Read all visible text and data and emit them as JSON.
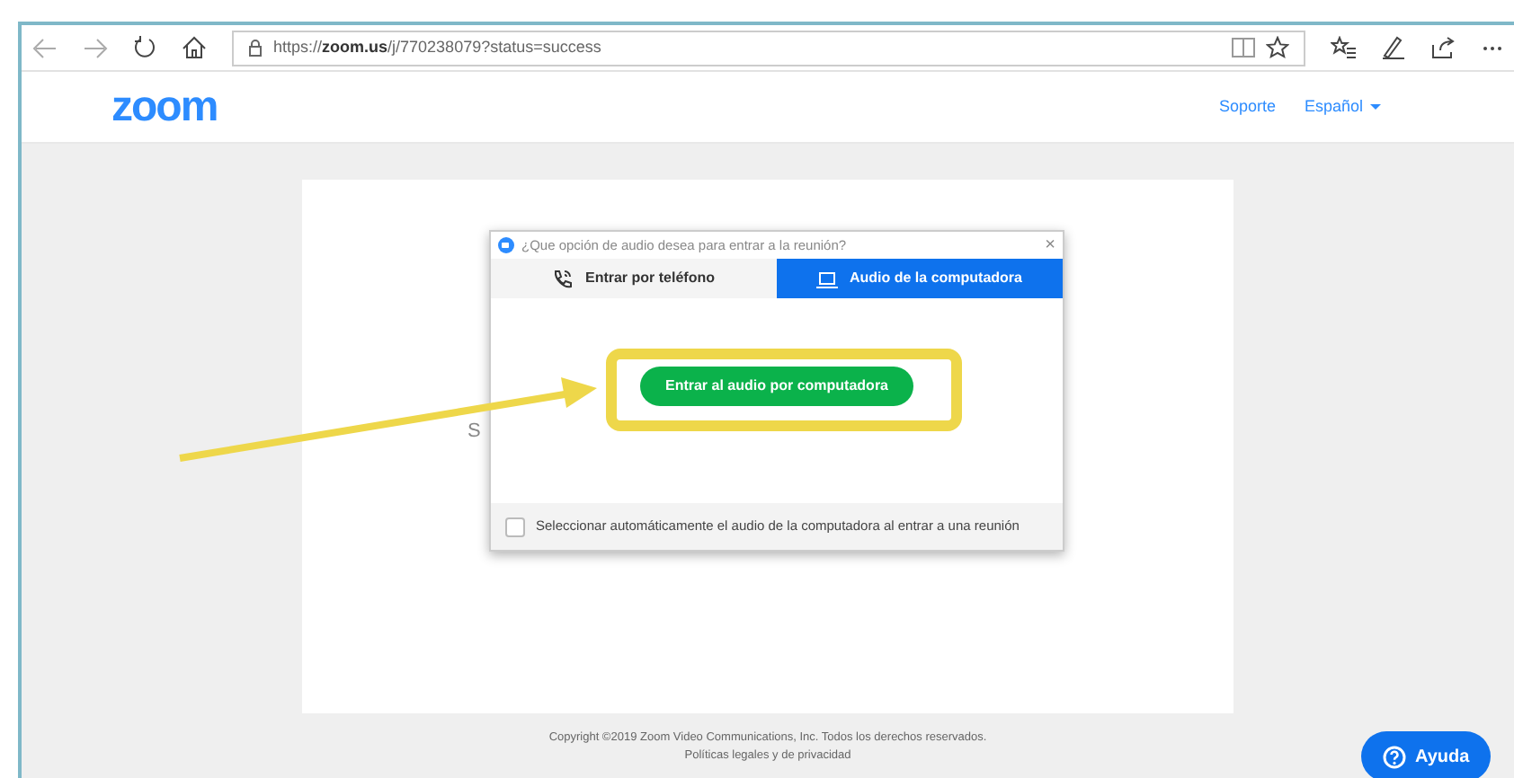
{
  "browser": {
    "url_prefix": "https://",
    "url_host": "zoom.us",
    "url_path": "/j/770238079?status=success"
  },
  "header": {
    "logo": "zoom",
    "links": [
      "Soporte"
    ],
    "language": "Español"
  },
  "page": {
    "hidden_text": "S"
  },
  "dialog": {
    "title": "¿Que opción de audio desea para entrar a la reunión?",
    "close": "×",
    "tabs": [
      {
        "label": "Entrar por teléfono",
        "kind": "phone",
        "selected": false
      },
      {
        "label": "Audio de la computadora",
        "kind": "computer",
        "selected": true
      }
    ],
    "join_button": "Entrar al audio por computadora",
    "auto_select": {
      "label": "Seleccionar automáticamente el audio de la computadora al entrar a una reunión",
      "checked": false
    }
  },
  "footer": {
    "copyright": "Copyright ©2019 Zoom Video Communications, Inc. Todos los derechos reservados.",
    "legal": "Políticas legales y de privacidad"
  },
  "help_button": "Ayuda"
}
